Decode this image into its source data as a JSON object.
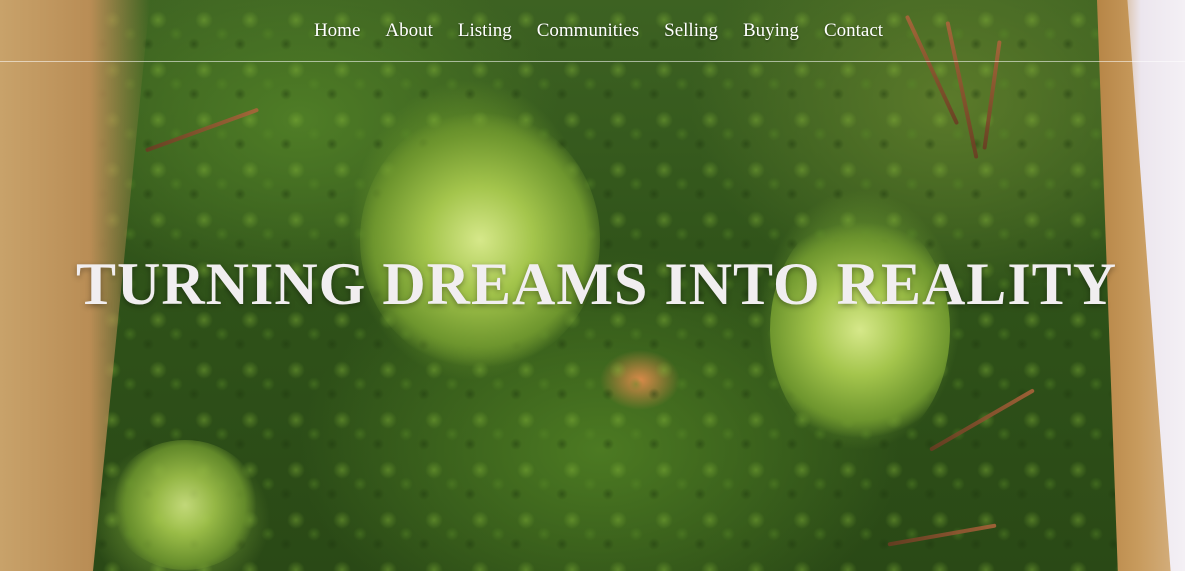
{
  "nav": {
    "items": [
      {
        "label": "Home"
      },
      {
        "label": "About"
      },
      {
        "label": "Listing"
      },
      {
        "label": "Communities"
      },
      {
        "label": "Selling"
      },
      {
        "label": "Buying"
      },
      {
        "label": "Contact"
      }
    ]
  },
  "hero": {
    "headline": "TURNING DREAMS INTO REALITY",
    "background": "succulent-plant-wall-photo"
  },
  "colors": {
    "nav_text": "#ffffff",
    "headline_text": "#f1eef0",
    "divider": "#ffffff"
  }
}
